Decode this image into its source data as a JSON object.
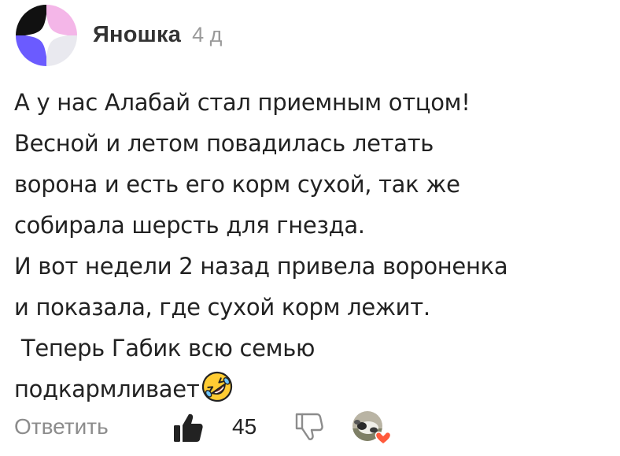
{
  "comment": {
    "author": "Яношка",
    "timestamp": "4 д",
    "lines": [
      "А у нас Алабай стал приемным отцом!",
      "Весной и летом повадилась летать",
      "ворона и  есть его корм сухой, так же",
      "собирала шерсть для гнезда.",
      "И вот недели 2 назад привела вороненка",
      "и показала,  где сухой корм лежит.",
      " Теперь Габик всю семью",
      "подкармливает"
    ],
    "emoji": "rolling-on-floor-laughing-emoji"
  },
  "actions": {
    "reply_label": "Ответить",
    "like_count": "45",
    "like_icon": "thumbs-up-icon",
    "dislike_icon": "thumbs-down-icon",
    "liker_reaction_icon": "heart-icon"
  },
  "colors": {
    "avatar_black": "#111111",
    "avatar_pink": "#f4b6e8",
    "avatar_purple": "#6b5bff",
    "avatar_light": "#e9e9ef",
    "muted_text": "#8c8c8c",
    "heart": "#ff5a3c"
  }
}
